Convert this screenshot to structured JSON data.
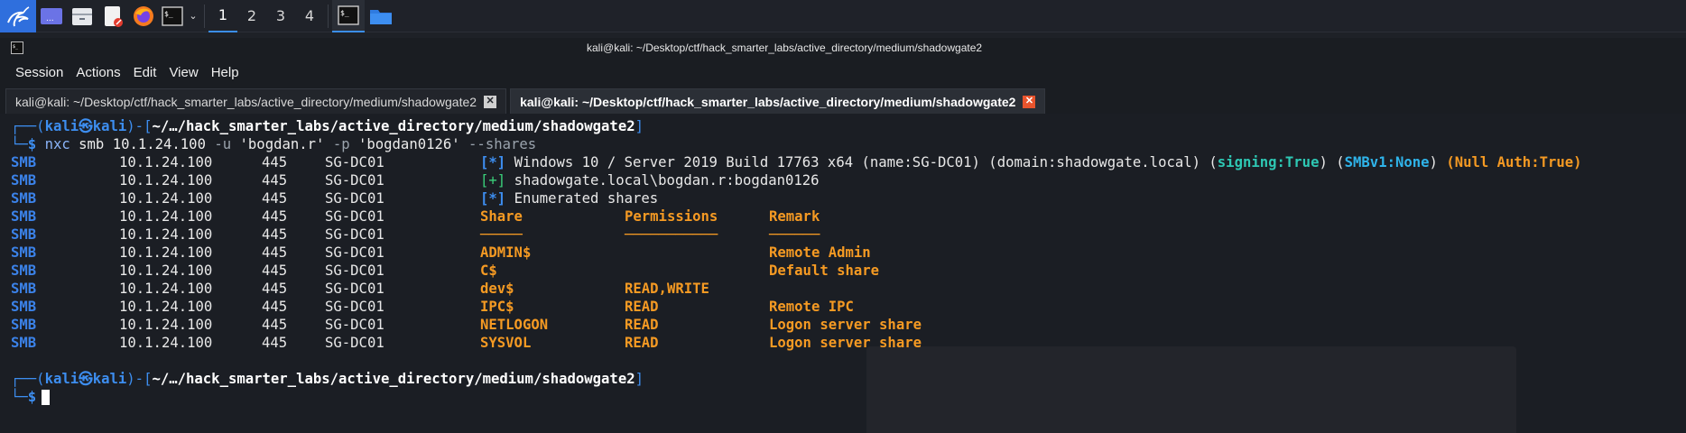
{
  "panel": {
    "workspaces": [
      "1",
      "2",
      "3",
      "4"
    ],
    "active_workspace": "1",
    "accent": "#3b8eea"
  },
  "window": {
    "title": "kali@kali: ~/Desktop/ctf/hack_smarter_labs/active_directory/medium/shadowgate2"
  },
  "menu": [
    "Session",
    "Actions",
    "Edit",
    "View",
    "Help"
  ],
  "tabs": [
    {
      "label": "kali@kali: ~/Desktop/ctf/hack_smarter_labs/active_directory/medium/shadowgate2",
      "active": false
    },
    {
      "label": "kali@kali: ~/Desktop/ctf/hack_smarter_labs/active_directory/medium/shadowgate2",
      "active": true
    }
  ],
  "terminal": {
    "prompt": {
      "open": "┌──(",
      "user": "kali",
      "at": "㉿",
      "host": "kali",
      "mid": ")-[",
      "path": "~/…/hack_smarter_labs/active_directory/medium/shadowgate2",
      "close": "]",
      "dollar_prefix": "└─",
      "dollar": "$"
    },
    "command": {
      "bin": "nxc",
      "proto": "smb",
      "ip": "10.1.24.100",
      "u_flag": "-u",
      "u_val": "'bogdan.r'",
      "p_flag": "-p",
      "p_val": "'bogdan0126'",
      "extra": "--shares"
    },
    "rows": [
      {
        "proto": "SMB",
        "ip": "10.1.24.100",
        "port": "445",
        "host": "SG-DC01",
        "kind": "info"
      },
      {
        "proto": "SMB",
        "ip": "10.1.24.100",
        "port": "445",
        "host": "SG-DC01",
        "kind": "success"
      },
      {
        "proto": "SMB",
        "ip": "10.1.24.100",
        "port": "445",
        "host": "SG-DC01",
        "kind": "enum"
      },
      {
        "proto": "SMB",
        "ip": "10.1.24.100",
        "port": "445",
        "host": "SG-DC01",
        "kind": "header"
      },
      {
        "proto": "SMB",
        "ip": "10.1.24.100",
        "port": "445",
        "host": "SG-DC01",
        "kind": "underline"
      },
      {
        "proto": "SMB",
        "ip": "10.1.24.100",
        "port": "445",
        "host": "SG-DC01",
        "kind": "share",
        "share": "ADMIN$",
        "perm": "",
        "remark": "Remote Admin"
      },
      {
        "proto": "SMB",
        "ip": "10.1.24.100",
        "port": "445",
        "host": "SG-DC01",
        "kind": "share",
        "share": "C$",
        "perm": "",
        "remark": "Default share"
      },
      {
        "proto": "SMB",
        "ip": "10.1.24.100",
        "port": "445",
        "host": "SG-DC01",
        "kind": "share",
        "share": "dev$",
        "perm": "READ,WRITE",
        "remark": ""
      },
      {
        "proto": "SMB",
        "ip": "10.1.24.100",
        "port": "445",
        "host": "SG-DC01",
        "kind": "share",
        "share": "IPC$",
        "perm": "READ",
        "remark": "Remote IPC"
      },
      {
        "proto": "SMB",
        "ip": "10.1.24.100",
        "port": "445",
        "host": "SG-DC01",
        "kind": "share",
        "share": "NETLOGON",
        "perm": "READ",
        "remark": "Logon server share"
      },
      {
        "proto": "SMB",
        "ip": "10.1.24.100",
        "port": "445",
        "host": "SG-DC01",
        "kind": "share",
        "share": "SYSVOL",
        "perm": "READ",
        "remark": "Logon server share"
      }
    ],
    "info": {
      "tag": "[*]",
      "os": "Windows 10 / Server 2019 Build 17763 x64 (name:SG-DC01) (domain:shadowgate.local) (",
      "signing": "signing:True",
      "between": ") (",
      "smbv1": "SMBv1:None",
      "after": ")",
      "nullauth": "(Null Auth:True)"
    },
    "success": {
      "tag": "[+]",
      "text": "shadowgate.local\\bogdan.r:bogdan0126"
    },
    "enum": {
      "tag": "[*]",
      "text": "Enumerated shares"
    },
    "header": {
      "share": "Share",
      "perm": "Permissions",
      "remark": "Remark"
    },
    "underline": {
      "share": "─────",
      "perm": "───────────",
      "remark": "──────"
    }
  }
}
